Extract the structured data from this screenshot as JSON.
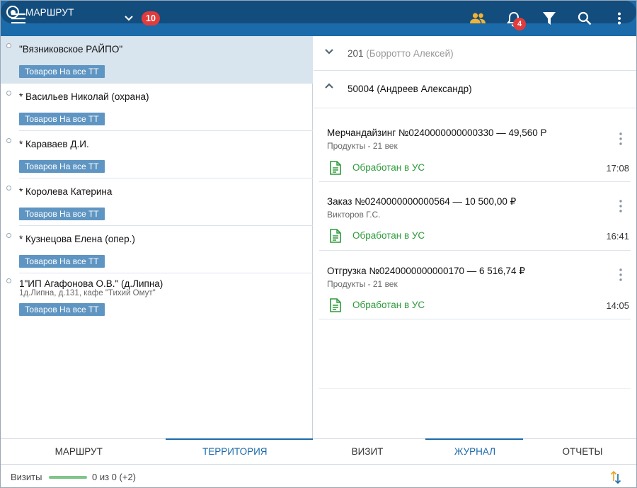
{
  "topbar": {
    "route_label": "МАРШРУТ",
    "route_count": "10",
    "notifications_count": "4",
    "colors": {
      "bar": "#1b6aaa",
      "pill": "#134d7e",
      "badge": "#e23b3b",
      "users_icon": "#f2b233"
    }
  },
  "left": {
    "stops": [
      {
        "name": "\"Вязниковское РАЙПО\"",
        "address": "",
        "tag": "Товаров На все ТТ",
        "selected": true
      },
      {
        "name": "* Васильев Николай (охрана)",
        "address": "",
        "tag": "Товаров На все ТТ",
        "selected": false
      },
      {
        "name": "* Караваев Д.И.",
        "address": "",
        "tag": "Товаров На все ТТ",
        "selected": false
      },
      {
        "name": "* Королева Катерина",
        "address": "",
        "tag": "Товаров На все ТТ",
        "selected": false
      },
      {
        "name": "* Кузнецова Елена (опер.)",
        "address": "",
        "tag": "Товаров На все ТТ",
        "selected": false
      },
      {
        "name": "1\"ИП Агафонова О.В.\" (д.Липна)",
        "address": "1д.Липна, д.131, кафе \"Тихий Омут\"",
        "tag": "Товаров На все ТТ",
        "selected": false
      }
    ],
    "tabs": [
      {
        "label": "МАРШРУТ",
        "active": false
      },
      {
        "label": "ТЕРРИТОРИЯ",
        "active": true
      }
    ]
  },
  "right": {
    "groups": [
      {
        "code": "201",
        "person": "(Борротто Алексей)",
        "expanded": false
      },
      {
        "code": "50004",
        "person": "(Андреев Александр)",
        "expanded": true
      }
    ],
    "documents": [
      {
        "title": "Мерчандайзинг №0240000000000330 — 49,560 Р",
        "subtitle": "Продукты - 21 век",
        "status": "Обработан в УС",
        "time": "17:08"
      },
      {
        "title": "Заказ №0240000000000564 — 10 500,00 ₽",
        "subtitle": "Викторов Г.С.",
        "status": "Обработан в УС",
        "time": "16:41"
      },
      {
        "title": "Отгрузка №0240000000000170 — 6 516,74 ₽",
        "subtitle": "Продукты - 21 век",
        "status": "Обработан в УС",
        "time": "14:05"
      }
    ],
    "tabs": [
      {
        "label": "ВИЗИТ",
        "active": false
      },
      {
        "label": "ЖУРНАЛ",
        "active": true
      },
      {
        "label": "ОТЧЕТЫ",
        "active": false
      }
    ]
  },
  "statusbar": {
    "label": "Визиты",
    "count": "0 из 0 (+2)",
    "progress": 1.0
  }
}
